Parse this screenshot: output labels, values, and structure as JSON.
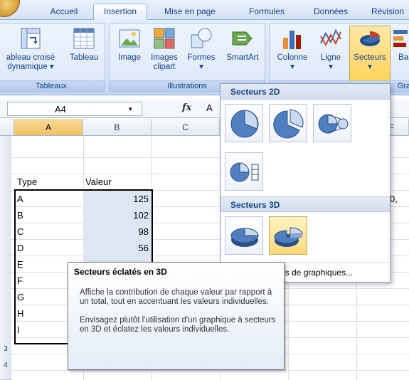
{
  "tabs": [
    {
      "label": "Accueil",
      "active": false
    },
    {
      "label": "Insertion",
      "active": true
    },
    {
      "label": "Mise en page",
      "active": false
    },
    {
      "label": "Formules",
      "active": false
    },
    {
      "label": "Données",
      "active": false
    },
    {
      "label": "Révision",
      "active": false
    }
  ],
  "ribbon": {
    "tableaux": {
      "label": "Tableaux",
      "buttons": [
        {
          "line1": "ableau croisé",
          "line2": "dynamique ▾"
        },
        {
          "line1": "Tableau",
          "line2": ""
        }
      ]
    },
    "illustrations": {
      "label": "Illustrations",
      "buttons": [
        {
          "line1": "Image",
          "line2": ""
        },
        {
          "line1": "Images",
          "line2": "clipart"
        },
        {
          "line1": "Formes",
          "line2": "▾"
        },
        {
          "line1": "SmartArt",
          "line2": ""
        }
      ]
    },
    "graphiques": {
      "label": "Grap",
      "buttons": [
        {
          "line1": "Colonne",
          "line2": "▾"
        },
        {
          "line1": "Ligne",
          "line2": "▾"
        },
        {
          "line1": "Secteurs",
          "line2": "▾"
        },
        {
          "line1": "Bar",
          "line2": ""
        }
      ]
    }
  },
  "formula_bar": {
    "name_box": "A4",
    "dropdown": "▾",
    "fx": "fx",
    "value": "A"
  },
  "columns": [
    "A",
    "B",
    "C"
  ],
  "column_f": "F",
  "row_numbers": [
    "3",
    "4"
  ],
  "table": {
    "headers": [
      "Type",
      "Valeur"
    ],
    "rows": [
      {
        "type": "A",
        "value": "125"
      },
      {
        "type": "B",
        "value": "102"
      },
      {
        "type": "C",
        "value": "98"
      },
      {
        "type": "D",
        "value": "56"
      },
      {
        "type": "E",
        "value": ""
      },
      {
        "type": "F",
        "value": ""
      },
      {
        "type": "G",
        "value": ""
      },
      {
        "type": "H",
        "value": ""
      },
      {
        "type": "I",
        "value": ""
      }
    ]
  },
  "cell_f_partial": "0,",
  "gallery": {
    "section_2d": "Secteurs 2D",
    "section_3d": "Secteurs 3D",
    "footer": "es de graphiques..."
  },
  "tooltip": {
    "title": "Secteurs éclatés en 3D",
    "paragraph1": "Affiche la contribution de chaque valeur par rapport à un total, tout en accentuant les valeurs individuelles.",
    "paragraph2": "Envisagez plutôt l'utilisation d'un graphique à secteurs en 3D et éclatez les valeurs individuelles."
  },
  "colors": {
    "ribbon_text": "#15428b",
    "selected_column": "#f1c15f",
    "hover_item": "#ffd978",
    "pie_blue": "#4f7fbf"
  }
}
